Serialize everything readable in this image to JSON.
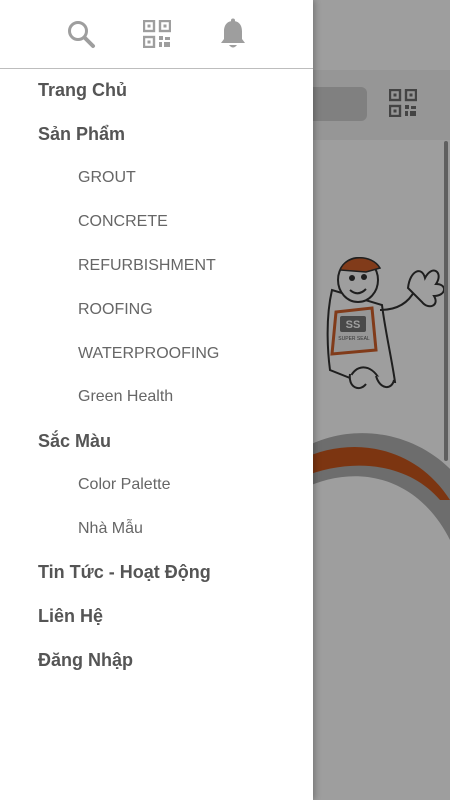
{
  "drawer": {
    "header_icons": [
      "search-icon",
      "qr-code-icon",
      "bell-icon"
    ],
    "menu": [
      {
        "label": "Trang Chủ",
        "level": 1
      },
      {
        "label": "Sản Phẩm",
        "level": 1
      },
      {
        "label": "GROUT",
        "level": 2
      },
      {
        "label": "CONCRETE",
        "level": 2
      },
      {
        "label": "REFURBISHMENT",
        "level": 2
      },
      {
        "label": "ROOFING",
        "level": 2
      },
      {
        "label": "WATERPROOFING",
        "level": 2
      },
      {
        "label": "Green Health",
        "level": 2
      },
      {
        "label": "Sắc Màu",
        "level": 1
      },
      {
        "label": "Color Palette",
        "level": 2
      },
      {
        "label": "Nhà Mẫu",
        "level": 2
      },
      {
        "label": "Tin Tức - Hoạt Động",
        "level": 1
      },
      {
        "label": "Liên Hệ",
        "level": 1
      },
      {
        "label": "Đăng Nhập",
        "level": 1
      }
    ]
  },
  "background": {
    "mascot_badge_text": "SS",
    "mascot_shirt_text": "SUPER SEAL",
    "accent_color": "#c8561c"
  },
  "colors": {
    "icon_gray": "#9e9e9e",
    "level1_text": "#555555",
    "level2_text": "#666666"
  }
}
